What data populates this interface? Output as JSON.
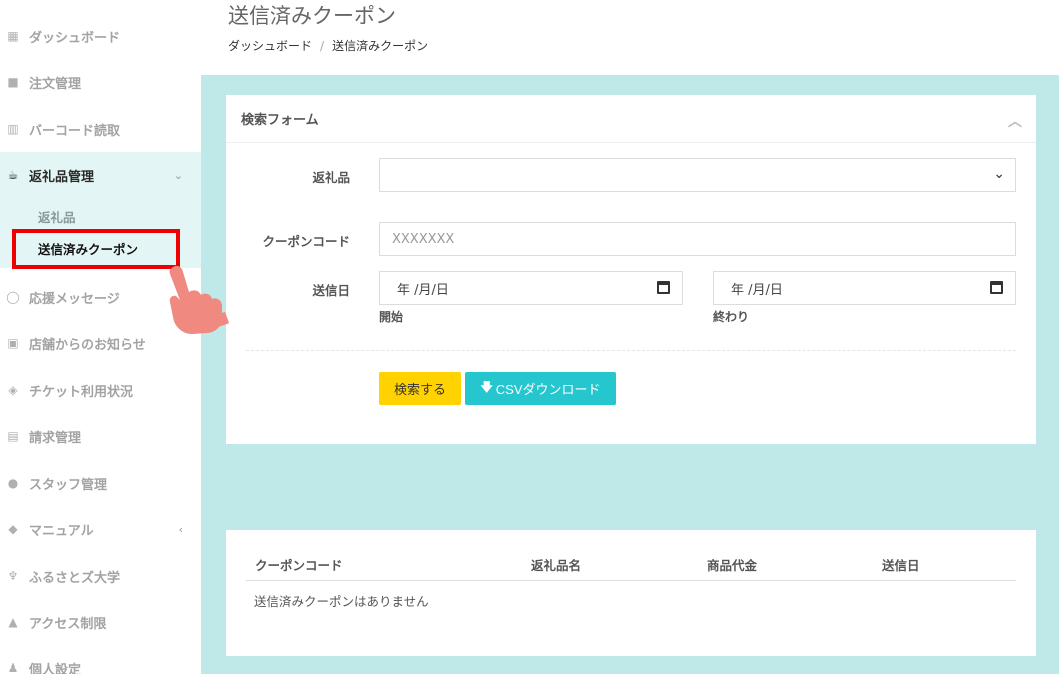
{
  "sidebar": {
    "items": [
      {
        "label": "ダッシュボード",
        "icon": "dashboard-icon"
      },
      {
        "label": "注文管理",
        "icon": "shopping-bag-icon"
      },
      {
        "label": "バーコード読取",
        "icon": "barcode-icon"
      },
      {
        "label": "返礼品管理",
        "icon": "gift-box-icon"
      },
      {
        "label": "応援メッセージ",
        "icon": "speech-bubble-icon"
      },
      {
        "label": "店舗からのお知らせ",
        "icon": "present-icon"
      },
      {
        "label": "チケット利用状況",
        "icon": "ticket-icon"
      },
      {
        "label": "請求管理",
        "icon": "money-bill-icon"
      },
      {
        "label": "スタッフ管理",
        "icon": "users-icon"
      },
      {
        "label": "マニュアル",
        "icon": "graduation-cap-icon"
      },
      {
        "label": "ふるさとズ大学",
        "icon": "trophy-icon"
      },
      {
        "label": "アクセス制限",
        "icon": "warning-icon"
      },
      {
        "label": "個人設定",
        "icon": "user-icon"
      }
    ],
    "sub_items": [
      {
        "label": "返礼品"
      },
      {
        "label": "送信済みクーポン"
      }
    ]
  },
  "header": {
    "title": "送信済みクーポン",
    "breadcrumb": [
      "ダッシュボード",
      "送信済みクーポン"
    ],
    "breadcrumb_sep": "/"
  },
  "search_form": {
    "title": "検索フォーム",
    "gift_label": "返礼品",
    "gift_value": "",
    "coupon_label": "クーポンコード",
    "coupon_placeholder": "XXXXXXX",
    "date_label": "送信日",
    "date_start_value": "年 /月/日",
    "date_end_value": "年 /月/日",
    "start_label": "開始",
    "end_label": "終わり",
    "search_button": "検索する",
    "csv_button": "CSVダウンロード"
  },
  "table": {
    "columns": [
      "クーポンコード",
      "返礼品名",
      "商品代金",
      "送信日"
    ],
    "empty_message": "送信済みクーポンはありません"
  },
  "colors": {
    "accent": "#26c6cf",
    "search_button": "#ffd200",
    "content_bg": "#bfe8e8",
    "highlight": "#ee0000"
  }
}
